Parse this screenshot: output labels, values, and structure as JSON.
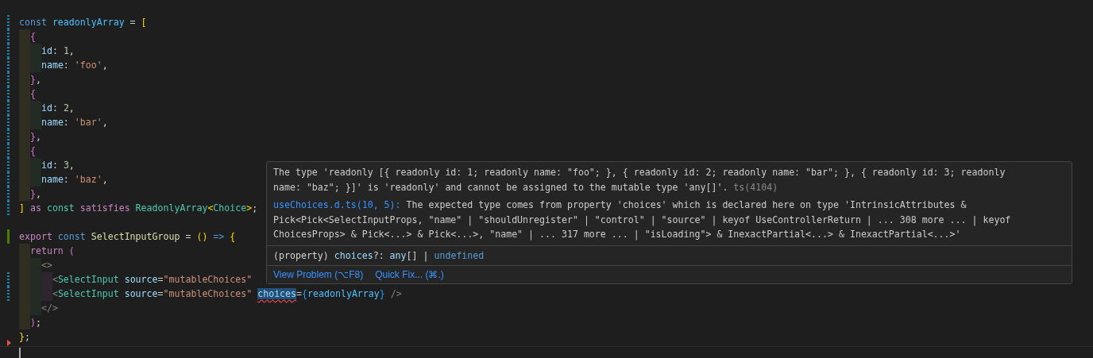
{
  "editor": {
    "lines": [
      {
        "kind": "modified",
        "tokens": [
          {
            "text": "const",
            "kind": "kw"
          },
          {
            "text": " readonlyArray",
            "kind": "var"
          },
          {
            "text": " = ",
            "kind": "punct"
          },
          {
            "text": "[",
            "kind": "b1"
          }
        ]
      },
      {
        "kind": "modified",
        "tokens": [
          {
            "text": "  {",
            "kind": "b2"
          }
        ]
      },
      {
        "kind": "modified",
        "tokens": [
          {
            "text": "    id",
            "kind": "prop"
          },
          {
            "text": ": ",
            "kind": "punct"
          },
          {
            "text": "1",
            "kind": "num"
          },
          {
            "text": ",",
            "kind": "punct"
          }
        ]
      },
      {
        "kind": "modified",
        "tokens": [
          {
            "text": "    name",
            "kind": "prop"
          },
          {
            "text": ": ",
            "kind": "punct"
          },
          {
            "text": "'foo'",
            "kind": "str"
          },
          {
            "text": ",",
            "kind": "punct"
          }
        ]
      },
      {
        "kind": "modified",
        "tokens": [
          {
            "text": "  }",
            "kind": "b2"
          },
          {
            "text": ",",
            "kind": "punct"
          }
        ]
      },
      {
        "kind": "modified",
        "tokens": [
          {
            "text": "  {",
            "kind": "b2"
          }
        ]
      },
      {
        "kind": "modified",
        "tokens": [
          {
            "text": "    id",
            "kind": "prop"
          },
          {
            "text": ": ",
            "kind": "punct"
          },
          {
            "text": "2",
            "kind": "num"
          },
          {
            "text": ",",
            "kind": "punct"
          }
        ]
      },
      {
        "kind": "modified",
        "tokens": [
          {
            "text": "    name",
            "kind": "prop"
          },
          {
            "text": ": ",
            "kind": "punct"
          },
          {
            "text": "'bar'",
            "kind": "str"
          },
          {
            "text": ",",
            "kind": "punct"
          }
        ]
      },
      {
        "kind": "modified",
        "tokens": [
          {
            "text": "  }",
            "kind": "b2"
          },
          {
            "text": ",",
            "kind": "punct"
          }
        ]
      },
      {
        "kind": "modified",
        "tokens": [
          {
            "text": "  {",
            "kind": "b2"
          }
        ]
      },
      {
        "kind": "modified",
        "tokens": [
          {
            "text": "    id",
            "kind": "prop"
          },
          {
            "text": ": ",
            "kind": "punct"
          },
          {
            "text": "3",
            "kind": "num"
          },
          {
            "text": ",",
            "kind": "punct"
          }
        ]
      },
      {
        "kind": "modified",
        "tokens": [
          {
            "text": "    name",
            "kind": "prop"
          },
          {
            "text": ": ",
            "kind": "punct"
          },
          {
            "text": "'baz'",
            "kind": "str"
          },
          {
            "text": ",",
            "kind": "punct"
          }
        ]
      },
      {
        "kind": "modified",
        "tokens": [
          {
            "text": "  }",
            "kind": "b2"
          },
          {
            "text": ",",
            "kind": "punct"
          }
        ]
      },
      {
        "kind": "modified",
        "tokens": [
          {
            "text": "]",
            "kind": "b1"
          },
          {
            "text": " as",
            "kind": "ctl"
          },
          {
            "text": " const",
            "kind": "type"
          },
          {
            "text": " satisfies",
            "kind": "ctl"
          },
          {
            "text": " ReadonlyArray",
            "kind": "type"
          },
          {
            "text": "<",
            "kind": "b1"
          },
          {
            "text": "Choice",
            "kind": "type"
          },
          {
            "text": ">",
            "kind": "b1"
          },
          {
            "text": ";",
            "kind": "punct"
          }
        ]
      },
      {
        "kind": "unchanged"
      },
      {
        "kind": "added",
        "tokens": [
          {
            "text": "export",
            "kind": "ctl"
          },
          {
            "text": " const",
            "kind": "kw"
          },
          {
            "text": " SelectInputGroup",
            "kind": "fn"
          },
          {
            "text": " = ",
            "kind": "punct"
          },
          {
            "text": "()",
            "kind": "b1"
          },
          {
            "text": " =>",
            "kind": "kw"
          },
          {
            "text": " {",
            "kind": "b1"
          }
        ]
      },
      {
        "kind": "unchanged",
        "tokens": [
          {
            "text": "  return",
            "kind": "ctl"
          },
          {
            "text": " (",
            "kind": "b2"
          }
        ]
      },
      {
        "kind": "unchanged",
        "tokens": [
          {
            "text": "    <>",
            "kind": "tag"
          }
        ]
      },
      {
        "kind": "modified",
        "tokens": [
          {
            "text": "      <",
            "kind": "tag"
          },
          {
            "text": "SelectInput",
            "kind": "type"
          },
          {
            "text": " source",
            "kind": "prop"
          },
          {
            "text": "=",
            "kind": "punct"
          },
          {
            "text": "\"mutableChoices\"",
            "kind": "str"
          }
        ]
      },
      {
        "kind": "modified",
        "tokens": [
          {
            "text": "      <",
            "kind": "tag"
          },
          {
            "text": "SelectInput",
            "kind": "type"
          },
          {
            "text": " source",
            "kind": "prop"
          },
          {
            "text": "=",
            "kind": "punct"
          },
          {
            "text": "\"mutableChoices\"",
            "kind": "str"
          },
          {
            "text": " choices",
            "kind": "error"
          },
          {
            "text": "=",
            "kind": "punct"
          },
          {
            "text": "{",
            "kind": "b3"
          },
          {
            "text": "readonlyArray",
            "kind": "var"
          },
          {
            "text": "}",
            "kind": "b3"
          },
          {
            "text": " />",
            "kind": "tag"
          }
        ]
      },
      {
        "kind": "unchanged",
        "tokens": [
          {
            "text": "    </>",
            "kind": "tag"
          }
        ]
      },
      {
        "kind": "unchanged",
        "tokens": [
          {
            "text": "  )",
            "kind": "b2"
          },
          {
            "text": ";",
            "kind": "punct"
          }
        ]
      },
      {
        "kind": "deleted",
        "tokens": [
          {
            "text": "}",
            "kind": "b1"
          },
          {
            "text": ";",
            "kind": "punct"
          }
        ]
      },
      {
        "kind": "unchanged",
        "cursor": true
      }
    ]
  },
  "hover": {
    "problem": {
      "lines": [
        "The type 'readonly [{ readonly id: 1; readonly name: \"foo\"; }, { readonly id: 2; readonly name: \"bar\"; }, { readonly id: 3; readonly",
        "name: \"baz\"; }]' is 'readonly' and cannot be assigned to the mutable type 'any[]'."
      ],
      "code": "ts(4104)"
    },
    "related": {
      "link": "useChoices.d.ts(10, 5):",
      "lines": [
        " The expected type comes from property 'choices' which is declared here on type 'IntrinsicAttributes &",
        "Pick<Pick<SelectInputProps, \"name\" | \"shouldUnregister\" | \"control\" | \"source\" | keyof UseControllerReturn | ... 308 more ... | keyof",
        "ChoicesProps> & Pick<...> & Pick<...>, \"name\" | ... 317 more ... | \"isLoading\"> & InexactPartial<...> & InexactPartial<...>'"
      ]
    },
    "signature": [
      {
        "text": "(property)",
        "kind": "punct"
      },
      {
        "text": " choices",
        "kind": "prop"
      },
      {
        "text": "?: ",
        "kind": "punct"
      },
      {
        "text": "any",
        "kind": "prop"
      },
      {
        "text": "[] | ",
        "kind": "punct"
      },
      {
        "text": "undefined",
        "kind": "kw"
      }
    ],
    "actions": [
      "View Problem (⌥F8)",
      "Quick Fix... (⌘.)"
    ]
  }
}
